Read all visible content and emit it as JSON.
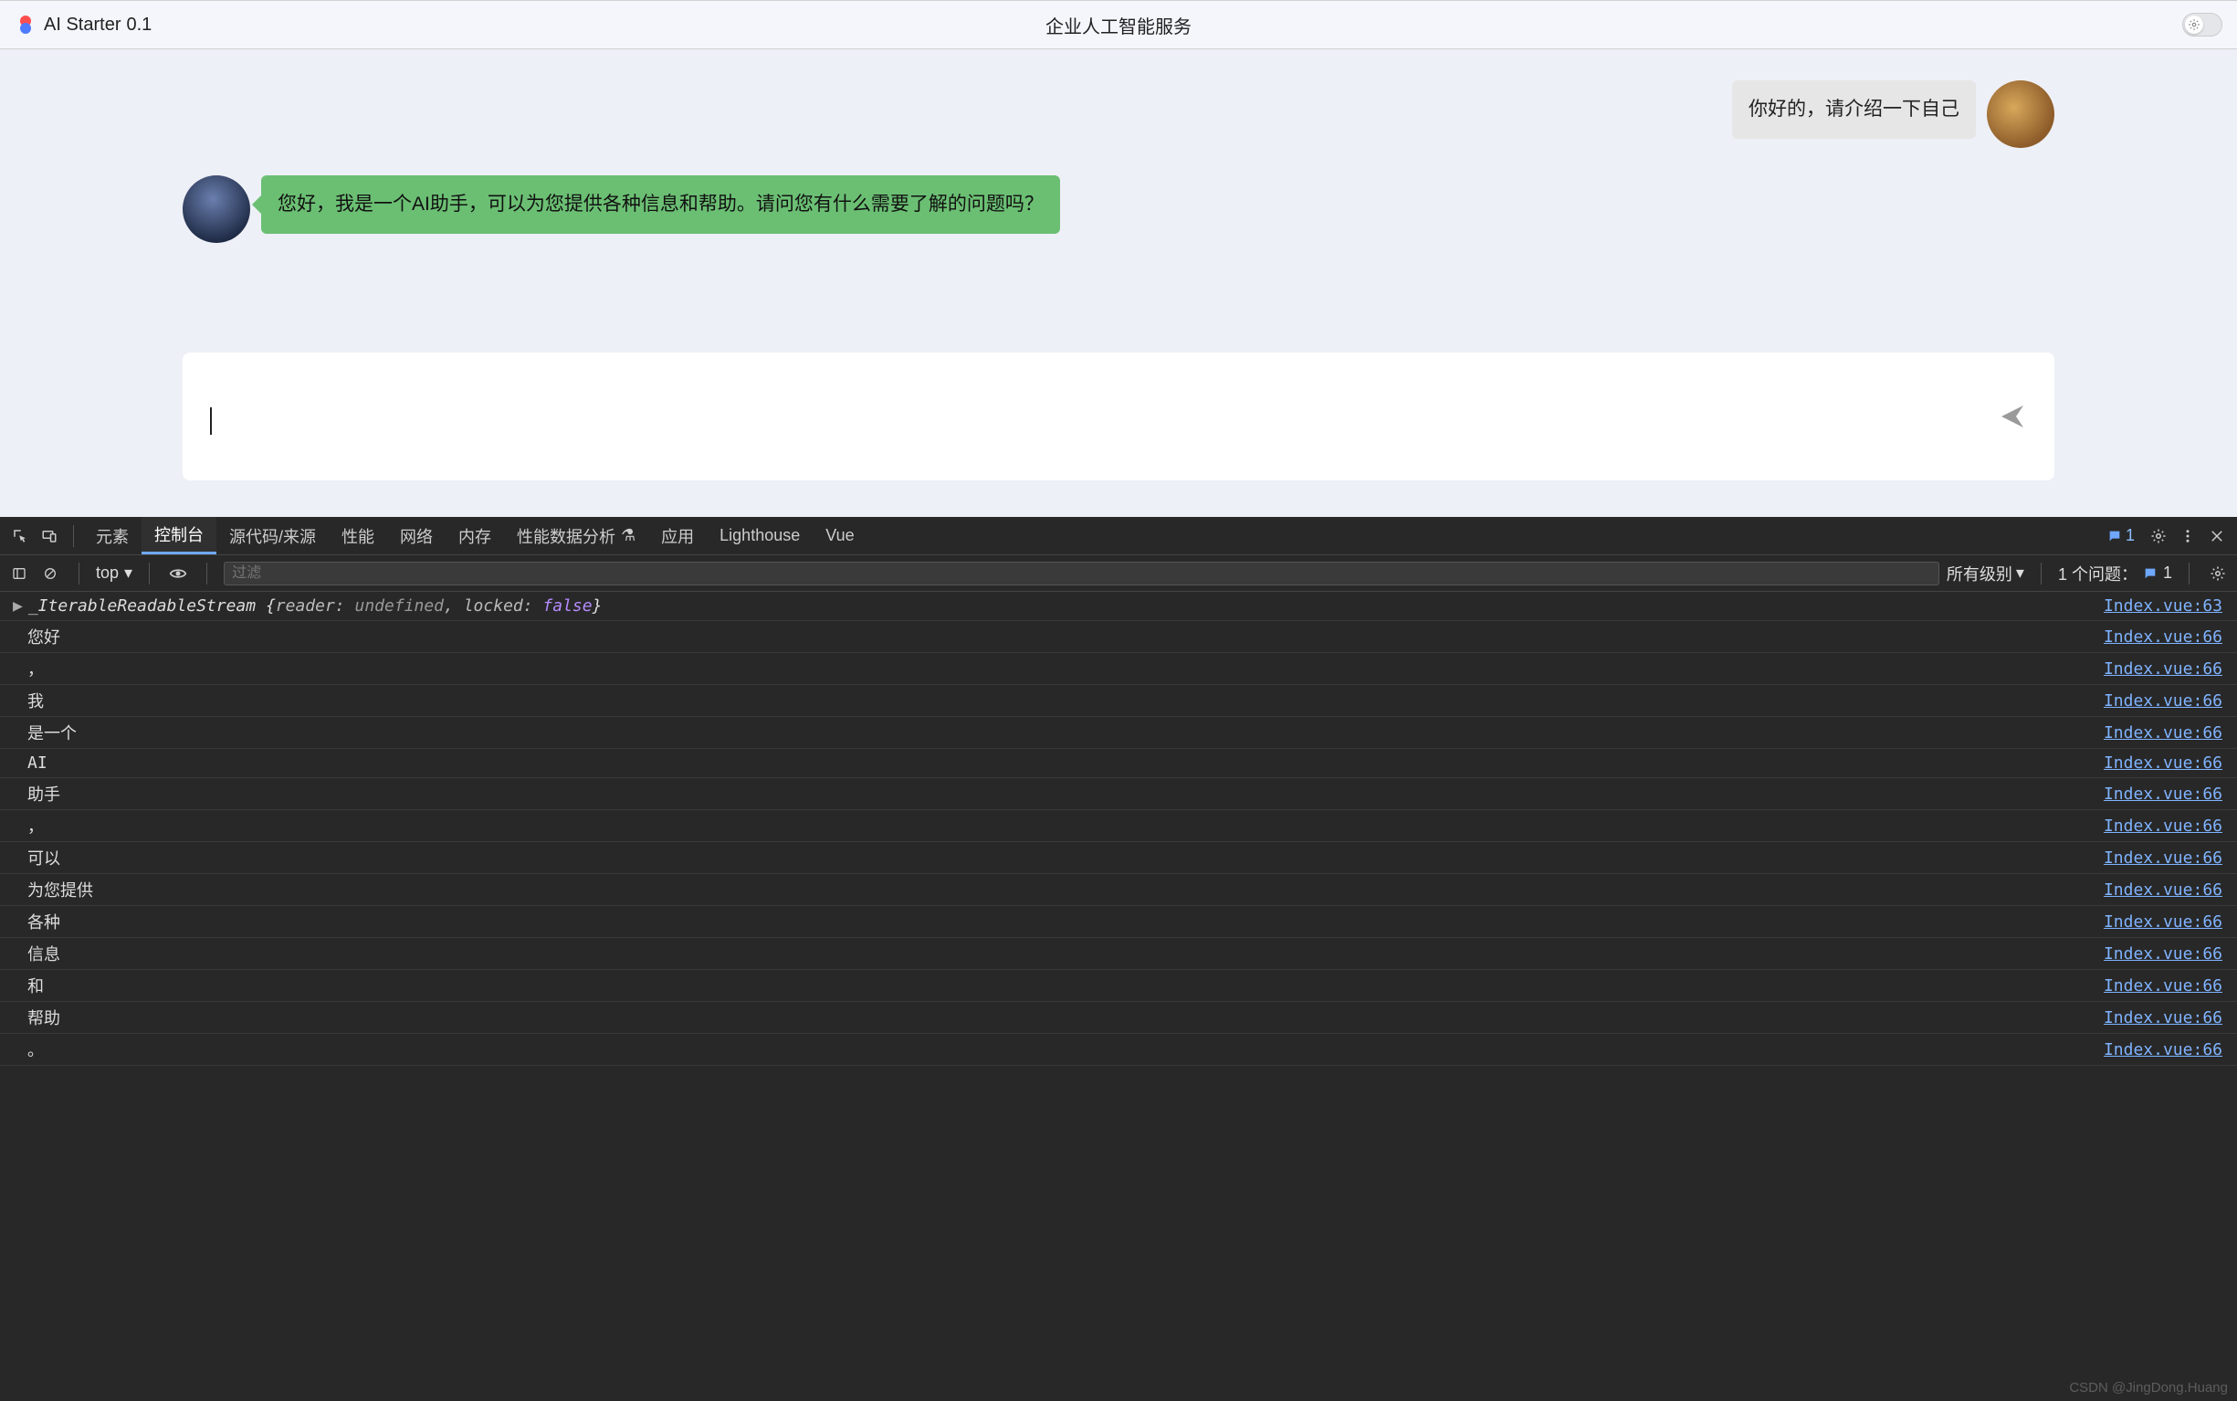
{
  "header": {
    "app_name": "AI Starter",
    "version": "0.1",
    "center_title": "企业人工智能服务"
  },
  "chat": {
    "user_message": "你好的，请介绍一下自己",
    "assistant_message": "您好，我是一个AI助手，可以为您提供各种信息和帮助。请问您有什么需要了解的问题吗？"
  },
  "input": {
    "placeholder": ""
  },
  "devtools": {
    "tabs": {
      "elements": "元素",
      "console": "控制台",
      "sources": "源代码/来源",
      "performance": "性能",
      "network": "网络",
      "memory": "内存",
      "perf_insights": "性能数据分析",
      "application": "应用",
      "lighthouse": "Lighthouse",
      "vue": "Vue"
    },
    "errors_badge": "1",
    "toolbar": {
      "context": "top",
      "filter_placeholder": "过滤",
      "levels": "所有级别",
      "issues_label": "1 个问题：",
      "issues_count": "1"
    },
    "logs": [
      {
        "first": true,
        "prefix": "▶",
        "class": "_IterableReadableStream",
        "open": "{",
        "p1": "reader:",
        "v1": "undefined",
        "sep": ",",
        "p2": "locked:",
        "v2": "false",
        "close": "}",
        "link": "Index.vue:63"
      },
      {
        "text": "您好",
        "link": "Index.vue:66"
      },
      {
        "text": "，",
        "link": "Index.vue:66"
      },
      {
        "text": "我",
        "link": "Index.vue:66"
      },
      {
        "text": "是一个",
        "link": "Index.vue:66"
      },
      {
        "text": "AI",
        "link": "Index.vue:66"
      },
      {
        "text": "助手",
        "link": "Index.vue:66"
      },
      {
        "text": "，",
        "link": "Index.vue:66"
      },
      {
        "text": "可以",
        "link": "Index.vue:66"
      },
      {
        "text": "为您提供",
        "link": "Index.vue:66"
      },
      {
        "text": "各种",
        "link": "Index.vue:66"
      },
      {
        "text": "信息",
        "link": "Index.vue:66"
      },
      {
        "text": "和",
        "link": "Index.vue:66"
      },
      {
        "text": "帮助",
        "link": "Index.vue:66"
      },
      {
        "text": "。",
        "link": "Index.vue:66"
      }
    ]
  },
  "watermark": "CSDN @JingDong.Huang"
}
